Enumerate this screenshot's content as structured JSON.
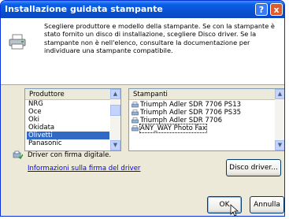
{
  "window": {
    "title": "Installazione guidata stampante"
  },
  "titlebar_buttons": {
    "help": "?",
    "close": "x"
  },
  "description": "Scegliere produttore e modello della stampante. Se con la stampante è stato fornito un disco di installazione, scegliere Disco driver. Se la stampante non è nell'elenco, consultare la documentazione per individuare una stampante compatibile.",
  "manufacturers": {
    "header": "Produttore",
    "items": [
      "NRG",
      "Oce",
      "Oki",
      "Okidata",
      "Olivetti",
      "Panasonic"
    ],
    "selected_index": 4
  },
  "printers": {
    "header": "Stampanti",
    "items": [
      "Triumph Adler SDR 7706 PS13",
      "Triumph Adler SDR 7706 PS35",
      "Triumph Adler SDR 7706",
      "ANY_WAY Photo Fax"
    ],
    "selected_index": 3
  },
  "signed_driver": "Driver con firma digitale.",
  "signing_link": "Informazioni sulla firma del driver",
  "buttons": {
    "disk": "Disco driver...",
    "ok": "OK",
    "cancel": "Annulla"
  },
  "colors": {
    "titlebar": "#0a5fe6",
    "selection": "#316ac5",
    "dialog_bg": "#ece9d8"
  }
}
